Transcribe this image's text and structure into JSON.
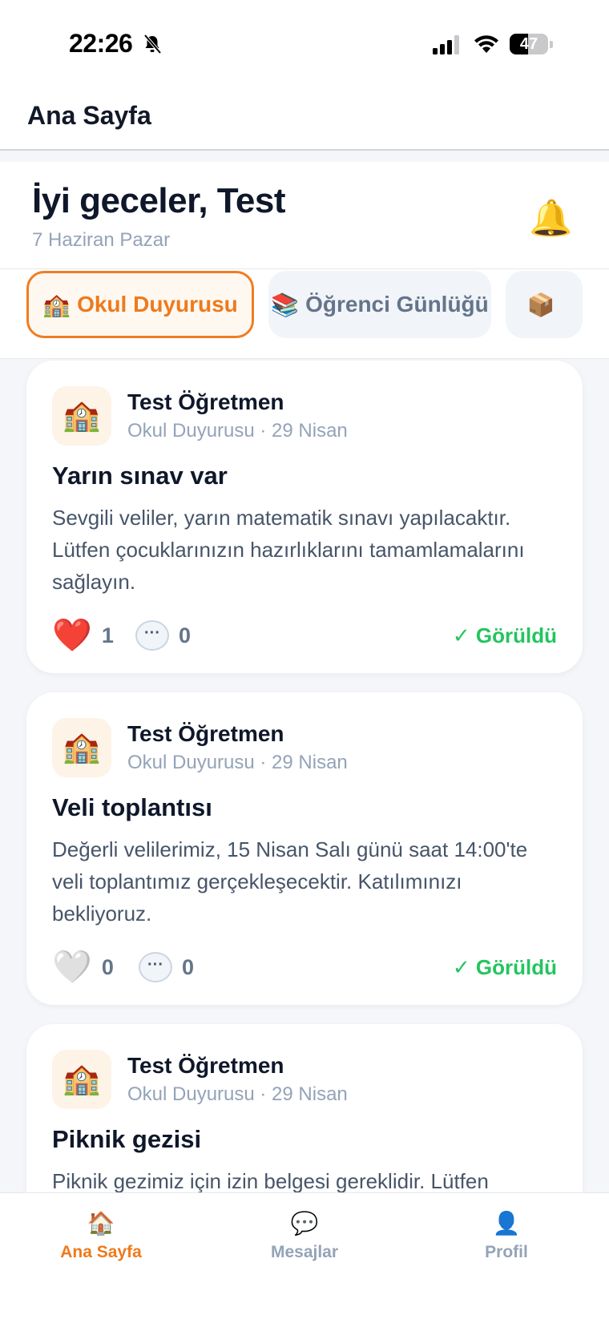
{
  "status_bar": {
    "time": "22:26",
    "battery_level": "47",
    "battery_fraction": 0.47
  },
  "nav": {
    "title": "Ana Sayfa"
  },
  "greeting": {
    "title": "İyi geceler, Test",
    "date": "7 Haziran Pazar",
    "bell_icon": "🔔"
  },
  "tabs": [
    {
      "emoji": "🏫",
      "label": "Okul Duyurusu",
      "active": true
    },
    {
      "emoji": "📚",
      "label": "Öğrenci Günlüğü",
      "active": false
    },
    {
      "emoji": "📦",
      "label": "",
      "active": false
    }
  ],
  "posts": [
    {
      "avatar": "🏫",
      "author": "Test Öğretmen",
      "meta": "Okul Duyurusu · 29 Nisan",
      "title": "Yarın sınav var",
      "body": "Sevgili veliler, yarın matematik sınavı yapılacaktır. Lütfen çocuklarınızın hazırlıklarını tamamlamalarını sağlayın.",
      "heart": "❤️",
      "likes": "1",
      "comments": "0",
      "seen": "✓ Görüldü"
    },
    {
      "avatar": "🏫",
      "author": "Test Öğretmen",
      "meta": "Okul Duyurusu · 29 Nisan",
      "title": "Veli toplantısı",
      "body": "Değerli velilerimiz, 15 Nisan Salı günü saat 14:00'te veli toplantımız gerçekleşecektir. Katılımınızı bekliyoruz.",
      "heart": "🤍",
      "likes": "0",
      "comments": "0",
      "seen": "✓ Görüldü"
    },
    {
      "avatar": "🏫",
      "author": "Test Öğretmen",
      "meta": "Okul Duyurusu · 29 Nisan",
      "title": "Piknik gezisi",
      "body": "Piknik gezimiz için izin belgesi gereklidir. Lütfen"
    }
  ],
  "comment_icon": "···",
  "tabbar": [
    {
      "icon": "🏠",
      "label": "Ana Sayfa",
      "active": true
    },
    {
      "icon": "💬",
      "label": "Mesajlar",
      "active": false
    },
    {
      "icon": "👤",
      "label": "Profil",
      "active": false
    }
  ],
  "colors": {
    "accent": "#ee7a1c",
    "seen_green": "#22c55e",
    "muted": "#94a3b8"
  }
}
